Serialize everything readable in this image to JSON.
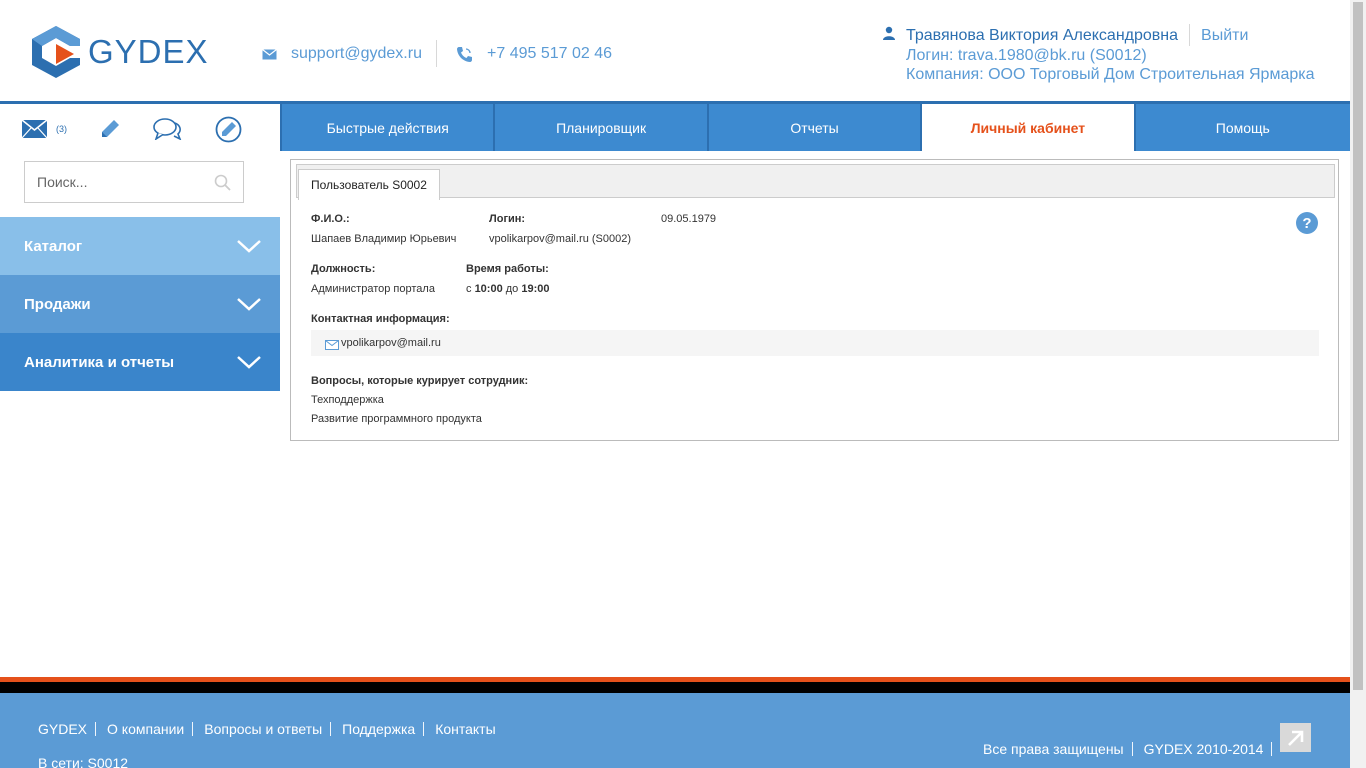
{
  "header": {
    "logo_text": "GYDEX",
    "email": "support@gydex.ru",
    "phone": "+7 495 517 02 46",
    "user_name": "Травянова Виктория Александровна",
    "logout": "Выйти",
    "login_line": "Логин: trava.1980@bk.ru (S0012)",
    "company_line": "Компания: ООО Торговый Дом Строительная Ярмарка"
  },
  "sidebar": {
    "mail_count": "(3)",
    "search_placeholder": "Поиск...",
    "menu": [
      {
        "label": "Каталог"
      },
      {
        "label": "Продажи"
      },
      {
        "label": "Аналитика и отчеты"
      }
    ]
  },
  "tabs": [
    {
      "label": "Быстрые действия"
    },
    {
      "label": "Планировщик"
    },
    {
      "label": "Отчеты"
    },
    {
      "label": "Личный кабинет",
      "active": true
    },
    {
      "label": "Помощь"
    }
  ],
  "profile": {
    "tab_label": "Пользователь S0002",
    "fio_label": "Ф.И.О.:",
    "fio_value": "Шапаев Владимир Юрьевич",
    "login_label": "Логин:",
    "login_value": "vpolikarpov@mail.ru (S0002)",
    "birth_date": "09.05.1979",
    "position_label": "Должность:",
    "position_value": "Администратор портала",
    "hours_label": "Время работы:",
    "hours_from_prefix": "с",
    "hours_from": "10:00",
    "hours_to_prefix": "до",
    "hours_to": "19:00",
    "contact_label": "Контактная информация:",
    "contact_email": "vpolikarpov@mail.ru",
    "questions_label": "Вопросы, которые курирует сотрудник:",
    "questions": [
      "Техподдержка",
      "Развитие программного продукта"
    ]
  },
  "footer": {
    "links": [
      "GYDEX",
      "О компании",
      "Вопросы и ответы",
      "Поддержка",
      "Контакты"
    ],
    "online": "В сети: S0012",
    "rights": "Все права защищены",
    "copyright": "GYDEX 2010-2014"
  },
  "colors": {
    "brand_blue": "#2c6fb0",
    "light_blue": "#5b9bd5",
    "accent_orange": "#e5511b"
  }
}
